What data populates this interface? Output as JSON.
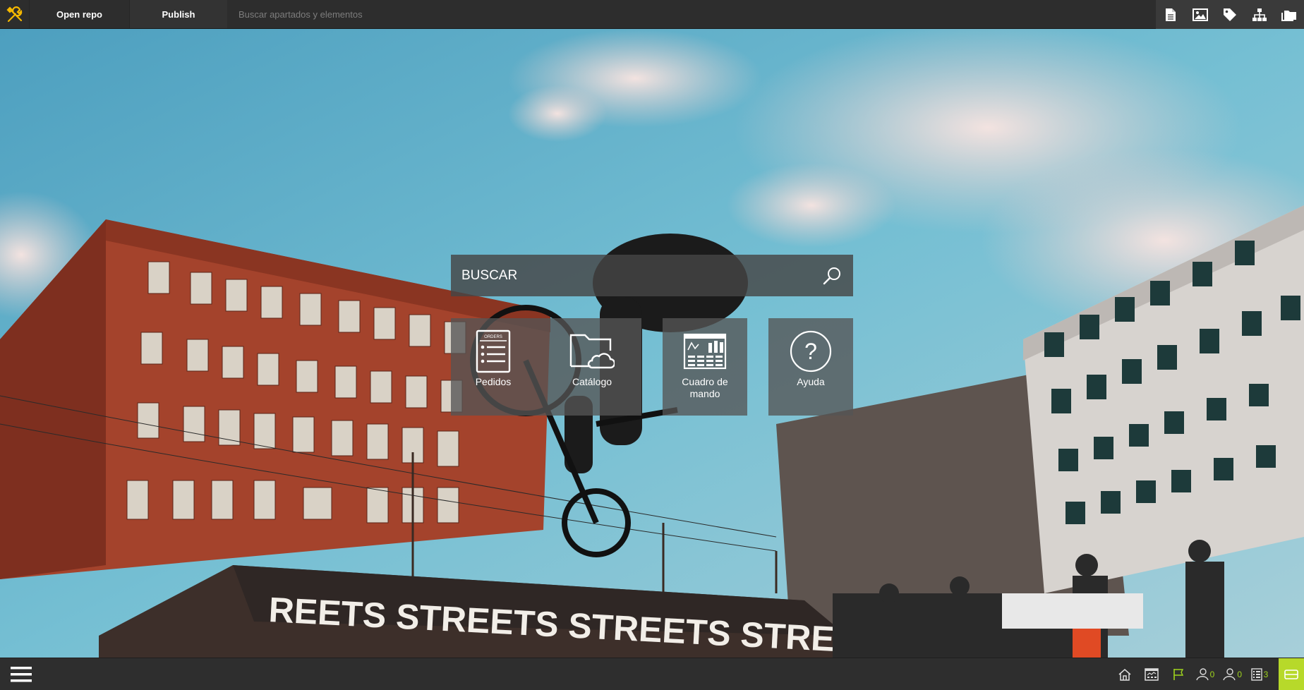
{
  "topbar": {
    "logo_icon": "tools-icon",
    "open_repo_label": "Open repo",
    "publish_label": "Publish",
    "search_placeholder": "Buscar apartados y elementos",
    "right_icons": [
      "document-icon",
      "image-icon",
      "tag-icon",
      "sitemap-icon",
      "folders-icon"
    ]
  },
  "search": {
    "placeholder": "BUSCAR",
    "button_icon": "search-icon"
  },
  "tiles": [
    {
      "label": "Pedidos",
      "icon": "orders-icon",
      "icon_caption": "ORDERS"
    },
    {
      "label": "Catálogo",
      "icon": "cloud-folder-icon"
    },
    {
      "label": "Cuadro de mando",
      "icon": "dashboard-icon"
    },
    {
      "label": "Ayuda",
      "icon": "help-icon"
    }
  ],
  "bottombar": {
    "menu_icon": "hamburger-menu-icon",
    "items": [
      {
        "icon": "home-icon"
      },
      {
        "icon": "chart-board-icon"
      },
      {
        "icon": "flag-icon"
      },
      {
        "icon": "user-icon",
        "count": "0"
      },
      {
        "icon": "users-icon",
        "count": "0"
      },
      {
        "icon": "list-icon",
        "count": "3"
      }
    ],
    "panel_icon": "panel-toggle-icon"
  },
  "colors": {
    "accent": "#b7d92a",
    "logo": "#f5b800",
    "bar": "#2d2d2d"
  }
}
